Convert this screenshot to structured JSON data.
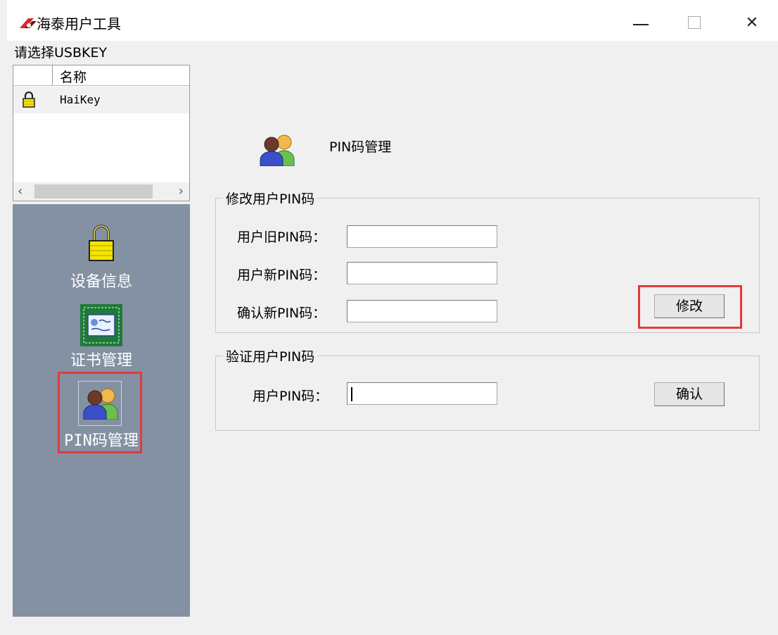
{
  "window": {
    "title": "海泰用户工具",
    "controls": {
      "minimize": "—",
      "maximize": "□",
      "close": "✕"
    }
  },
  "key_select": {
    "label": "请选择USBKEY",
    "column_header": "名称",
    "items": [
      {
        "name": "HaiKey",
        "icon": "lock-icon"
      }
    ],
    "scroll_left": "‹",
    "scroll_right": "›"
  },
  "nav": {
    "items": [
      {
        "label": "设备信息",
        "icon": "padlock-icon"
      },
      {
        "label": "证书管理",
        "icon": "certificate-icon"
      },
      {
        "label": "PIN码管理",
        "icon": "users-icon",
        "selected": true
      }
    ]
  },
  "main": {
    "title": "PIN码管理",
    "change_group": {
      "title": "修改用户PIN码",
      "old_label": "用户旧PIN码：",
      "new_label": "用户新PIN码：",
      "confirm_label": "确认新PIN码：",
      "old_value": "",
      "new_value": "",
      "confirm_value": "",
      "button": "修改"
    },
    "verify_group": {
      "title": "验证用户PIN码",
      "pin_label": "用户PIN码：",
      "pin_value": "",
      "button": "确认"
    }
  },
  "colors": {
    "nav_background": "#8391a3",
    "highlight_red": "#e33a3a",
    "window_background": "#f0f0f0"
  }
}
